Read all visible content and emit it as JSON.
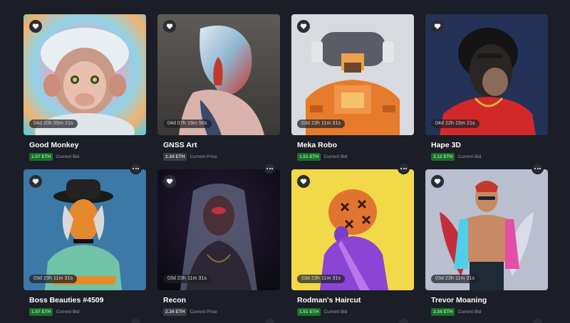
{
  "colors": {
    "background": "#1b1e26",
    "bid_badge": "#1e6b2e",
    "price_badge": "#3a3d45"
  },
  "icons": {
    "favorite": "heart-icon",
    "more": "more-dots-icon"
  },
  "items": [
    {
      "title": "Good Monkey",
      "timer": "04d 20h 55m 21s",
      "price": "1.57 ETH",
      "price_label": "Current Bid",
      "badge": "green"
    },
    {
      "title": "GNSS Art",
      "timer": "04d 07h 19m 56s",
      "price": "2.34 ETH",
      "price_label": "Current Price",
      "badge": "gray"
    },
    {
      "title": "Meka Robo",
      "timer": "03d 23h 11m 31s",
      "price": "1.51 ETH",
      "price_label": "Current Bid",
      "badge": "green"
    },
    {
      "title": "Hape 3D",
      "timer": "04d 22h 15m 21s",
      "price": "3.12 ETH",
      "price_label": "Current Bid",
      "badge": "green"
    },
    {
      "title": "Boss Beauties #4509",
      "timer": "03d 23h 11m 31s",
      "price": "1.57 ETH",
      "price_label": "Current Bid",
      "badge": "green"
    },
    {
      "title": "Recon",
      "timer": "03d 23h 11m 31s",
      "price": "2.34 ETH",
      "price_label": "Current Price",
      "badge": "gray"
    },
    {
      "title": "Rodman's Haircut",
      "timer": "03d 23h 11m 31s",
      "price": "1.51 ETH",
      "price_label": "Current Bid",
      "badge": "green"
    },
    {
      "title": "Trevor Moaning",
      "timer": "03d 23h 11m 31s",
      "price": "2.34 ETH",
      "price_label": "Current Bid",
      "badge": "green"
    }
  ]
}
